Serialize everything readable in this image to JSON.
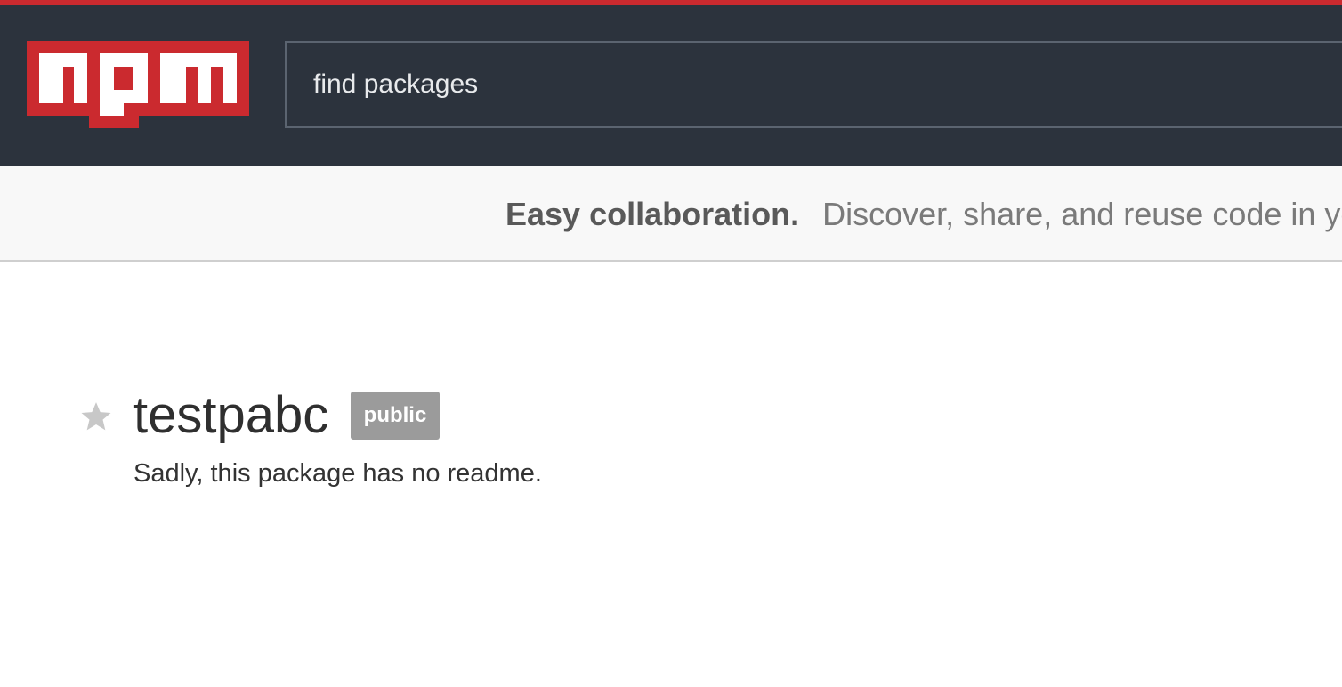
{
  "colors": {
    "brand_red": "#cb2a2f",
    "header_bg": "#2c333d",
    "badge_bg": "#9b9b9b",
    "star": "#c8c8c8"
  },
  "header": {
    "logo_text": "npm",
    "logo_icon": "npm-logo",
    "search": {
      "placeholder": "find packages",
      "value": ""
    }
  },
  "tagline": {
    "bold": "Easy collaboration.",
    "text": "Discover, share, and reuse code in yo"
  },
  "package": {
    "star_icon": "star-icon",
    "name": "testpabc",
    "visibility_badge": "public",
    "readme_message": "Sadly, this package has no readme."
  }
}
